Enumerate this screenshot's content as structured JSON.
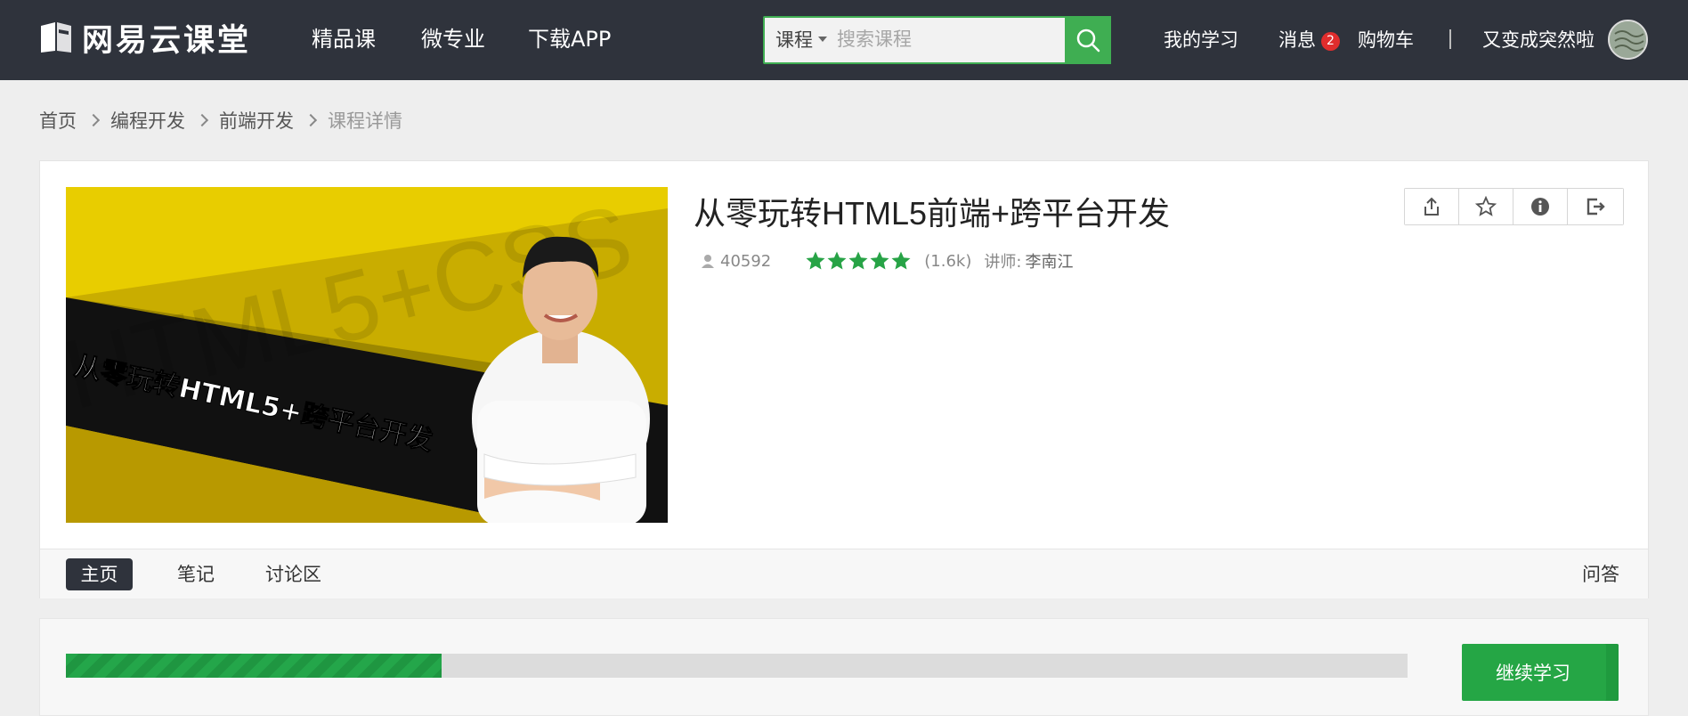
{
  "header": {
    "logo_text": "网易云课堂",
    "nav": [
      "精品课",
      "微专业",
      "下载APP"
    ],
    "search": {
      "type_label": "课程",
      "placeholder": "搜索课程"
    },
    "my_learning": "我的学习",
    "messages": "消息",
    "message_count": "2",
    "cart": "购物车",
    "username": "又变成突然啦"
  },
  "breadcrumb": [
    "首页",
    "编程开发",
    "前端开发",
    "课程详情"
  ],
  "course": {
    "title": "从零玩转HTML5前端+跨平台开发",
    "learners": "40592",
    "rating_stars": 5,
    "rating_count": "(1.6k)",
    "teacher_label": "讲师:",
    "teacher_name": "李南江",
    "cover": {
      "headline": "从零玩转HTML5+跨平台开发",
      "watermark": "HTML5+CSS"
    },
    "actions": [
      "share-icon",
      "star-icon",
      "info-icon",
      "exit-icon"
    ]
  },
  "tabs": {
    "items": [
      "主页",
      "笔记",
      "讨论区"
    ],
    "active": "主页",
    "right": "问答"
  },
  "progress": {
    "fraction": 0.28,
    "continue_label": "继续学习"
  },
  "colors": {
    "topbar": "#2f333c",
    "accent_green": "#3fae52",
    "badge_red": "#e02d2d",
    "cover_yellow": "#e6c400"
  }
}
